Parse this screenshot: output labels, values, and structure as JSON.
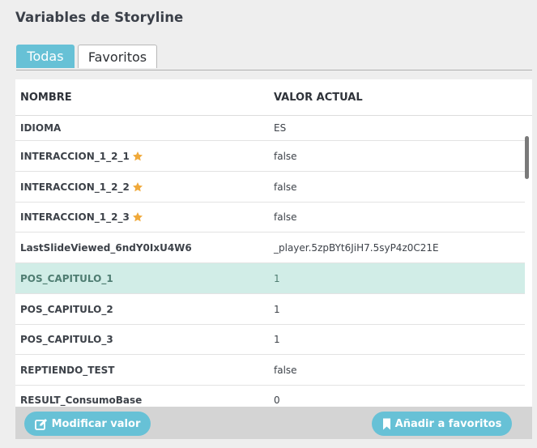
{
  "page": {
    "title": "Variables de Storyline"
  },
  "tabs": [
    {
      "label": "Todas",
      "active": true
    },
    {
      "label": "Favoritos",
      "active": false
    }
  ],
  "table": {
    "headers": {
      "name": "NOMBRE",
      "value": "VALOR ACTUAL"
    },
    "rows": [
      {
        "name": "IDIOMA",
        "value": "ES",
        "favorite": false,
        "selected": false
      },
      {
        "name": "INTERACCION_1_2_1",
        "value": "false",
        "favorite": true,
        "selected": false
      },
      {
        "name": "INTERACCION_1_2_2",
        "value": "false",
        "favorite": true,
        "selected": false
      },
      {
        "name": "INTERACCION_1_2_3",
        "value": "false",
        "favorite": true,
        "selected": false
      },
      {
        "name": "LastSlideViewed_6ndY0IxU4W6",
        "value": "_player.5zpBYt6JiH7.5syP4z0C21E",
        "favorite": false,
        "selected": false
      },
      {
        "name": "POS_CAPITULO_1",
        "value": "1",
        "favorite": false,
        "selected": true
      },
      {
        "name": "POS_CAPITULO_2",
        "value": "1",
        "favorite": false,
        "selected": false
      },
      {
        "name": "POS_CAPITULO_3",
        "value": "1",
        "favorite": false,
        "selected": false
      },
      {
        "name": "REPTIENDO_TEST",
        "value": "false",
        "favorite": false,
        "selected": false
      },
      {
        "name": "RESULT_ConsumoBase",
        "value": "0",
        "favorite": false,
        "selected": false
      }
    ]
  },
  "footer": {
    "edit_label": "Modificar valor",
    "favorite_label": "Añadir a favoritos"
  },
  "colors": {
    "accent": "#67c1d6",
    "selected_row": "#d1ede7",
    "star": "#f0a93a"
  },
  "icons": {
    "favorite": "star-icon",
    "edit": "edit-icon",
    "bookmark": "bookmark-icon"
  }
}
